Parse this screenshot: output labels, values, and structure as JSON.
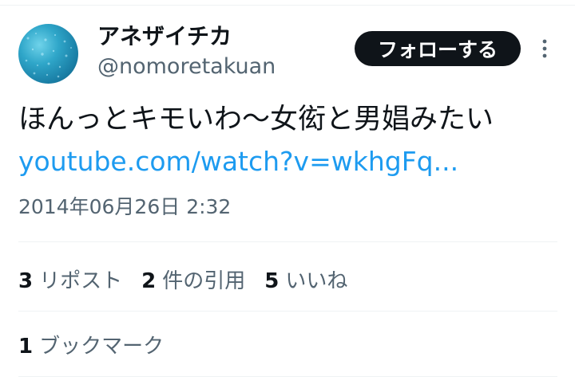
{
  "user": {
    "display_name": "アネザイチカ",
    "handle": "@nomoretakuan"
  },
  "follow_button": {
    "label": "フォローする"
  },
  "more_button": {
    "icon": "more-vertical-icon"
  },
  "tweet": {
    "text": "ほんっとキモいわ〜女衒と男娼みたい",
    "link": "youtube.com/watch?v=wkhgFq...",
    "timestamp": "2014年06月26日 2:32"
  },
  "stats": {
    "reposts": {
      "count": "3",
      "label": "リポスト"
    },
    "quotes": {
      "count": "2",
      "label": "件の引用"
    },
    "likes": {
      "count": "5",
      "label": "いいね"
    },
    "bookmarks": {
      "count": "1",
      "label": "ブックマーク"
    }
  },
  "colors": {
    "text_primary": "#0f1419",
    "text_secondary": "#536471",
    "link": "#1d9bf0",
    "divider": "#eff3f4",
    "button_bg": "#0f1419"
  }
}
